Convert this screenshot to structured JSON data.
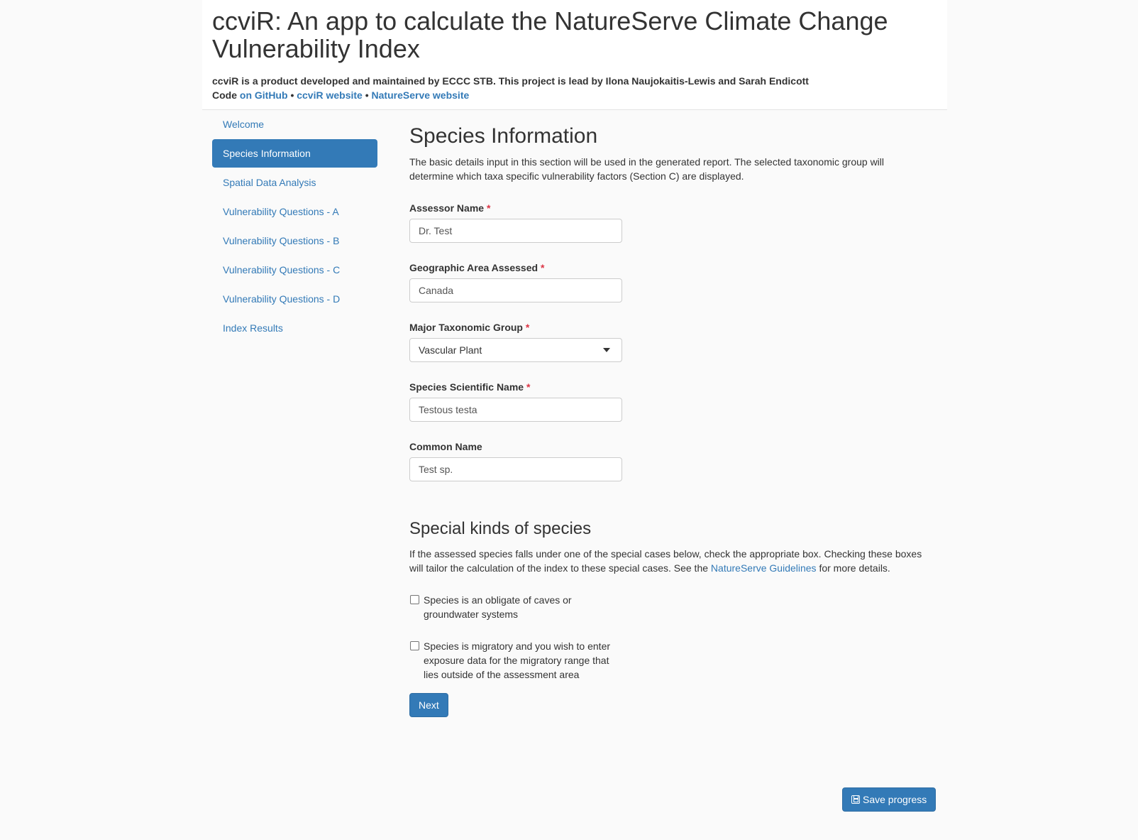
{
  "header": {
    "title": "ccviR: An app to calculate the NatureServe Climate Change Vulnerability Index",
    "subtitle": "ccviR is a product developed and maintained by ECCC STB. This project is lead by Ilona Naujokaitis-Lewis and Sarah Endicott",
    "code_prefix": "Code",
    "link_github": "on GitHub",
    "separator": "•",
    "link_ccvir": "ccviR website",
    "link_natureserve": "NatureServe website"
  },
  "sidebar": {
    "items": [
      {
        "label": "Welcome",
        "active": false
      },
      {
        "label": "Species Information",
        "active": true
      },
      {
        "label": "Spatial Data Analysis",
        "active": false
      },
      {
        "label": "Vulnerability Questions - A",
        "active": false
      },
      {
        "label": "Vulnerability Questions - B",
        "active": false
      },
      {
        "label": "Vulnerability Questions - C",
        "active": false
      },
      {
        "label": "Vulnerability Questions - D",
        "active": false
      },
      {
        "label": "Index Results",
        "active": false
      }
    ]
  },
  "main": {
    "title": "Species Information",
    "intro": "The basic details input in this section will be used in the generated report. The selected taxonomic group will determine which taxa specific vulnerability factors (Section C) are displayed.",
    "required_mark": "*",
    "fields": {
      "assessor": {
        "label": "Assessor Name",
        "value": "Dr. Test"
      },
      "geo_area": {
        "label": "Geographic Area Assessed",
        "value": "Canada"
      },
      "tax_group": {
        "label": "Major Taxonomic Group",
        "value": "Vascular Plant"
      },
      "sci_name": {
        "label": "Species Scientific Name",
        "value": "Testous testa"
      },
      "common_name": {
        "label": "Common Name",
        "value": "Test sp."
      }
    },
    "special": {
      "title": "Special kinds of species",
      "intro_before": "If the assessed species falls under one of the special cases below, check the appropriate box. Checking these boxes will tailor the calculation of the index to these special cases. See the ",
      "intro_link": "NatureServe Guidelines",
      "intro_after": " for more details.",
      "cave_label": "Species is an obligate of caves or groundwater systems",
      "cave_checked": false,
      "migratory_label": "Species is migratory and you wish to enter exposure data for the migratory range that lies outside of the assessment area",
      "migratory_checked": false
    },
    "next_label": "Next",
    "save_label": "Save progress"
  },
  "colors": {
    "accent": "#337ab7",
    "required": "#dc3545",
    "background": "#fafafa"
  }
}
